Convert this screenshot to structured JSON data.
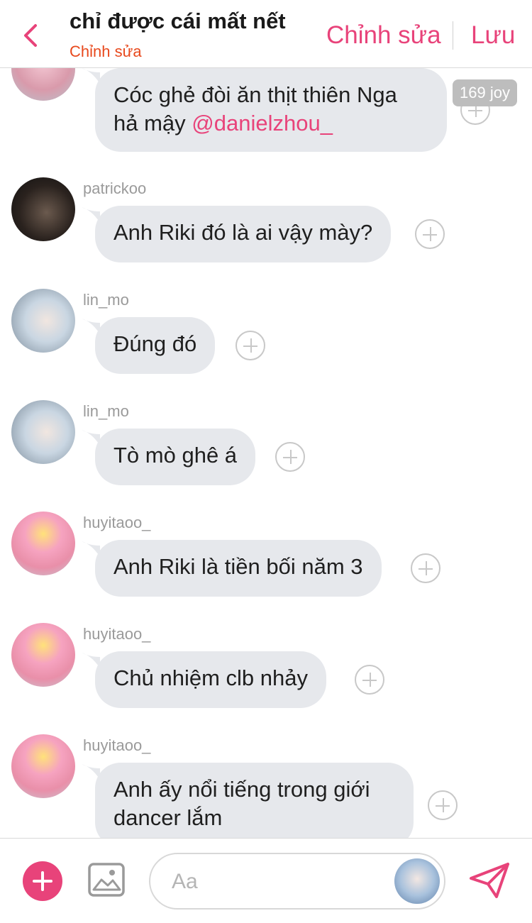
{
  "header": {
    "title": "chỉ được cái mất nết",
    "subtitle": "Chỉnh sửa",
    "edit_label": "Chỉnh sửa",
    "save_label": "Lưu"
  },
  "messages": [
    {
      "user": "",
      "text": "Cóc ghẻ đòi ăn thịt thiên Nga\nhả mậy ",
      "mention": "@danielzhou_"
    },
    {
      "user": "patrickoo",
      "text": "Anh Riki đó là ai vậy mày?"
    },
    {
      "user": "lin_mo",
      "text": "Đúng đó"
    },
    {
      "user": "lin_mo",
      "text": "Tò mò ghê á"
    },
    {
      "user": "huyitaoo_",
      "text": "Anh Riki là tiền bối năm 3"
    },
    {
      "user": "huyitaoo_",
      "text": "Chủ nhiệm clb nhảy"
    },
    {
      "user": "huyitaoo_",
      "text": "Anh ấy nổi tiếng trong giới\ndancer lắm"
    }
  ],
  "reaction_badge": "169 joy",
  "composer": {
    "placeholder": "Aa"
  },
  "colors": {
    "accent": "#e8437a",
    "subtitle": "#e8491d",
    "bubble": "#e6e8ec"
  }
}
